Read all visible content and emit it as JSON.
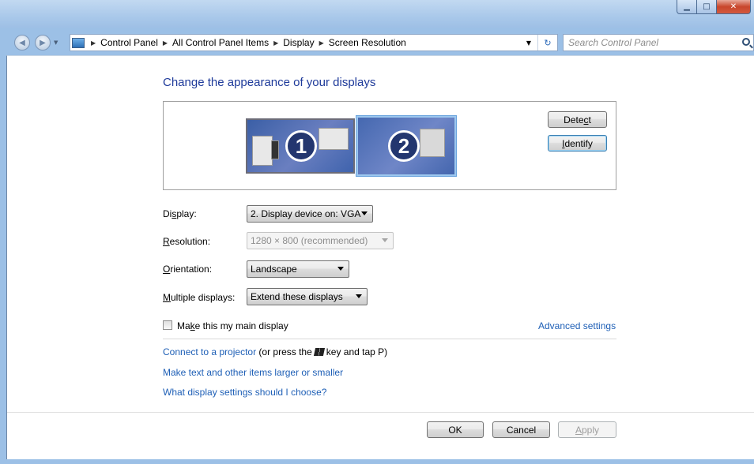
{
  "breadcrumb": [
    "Control Panel",
    "All Control Panel Items",
    "Display",
    "Screen Resolution"
  ],
  "search": {
    "placeholder": "Search Control Panel"
  },
  "page_title": "Change the appearance of your displays",
  "monitors": [
    {
      "number": "1",
      "selected": false
    },
    {
      "number": "2",
      "selected": true
    }
  ],
  "buttons": {
    "detect": {
      "pre": "Dete",
      "key": "c",
      "post": "t"
    },
    "identify": {
      "pre": "",
      "key": "I",
      "post": "dentify"
    },
    "ok": "OK",
    "cancel": "Cancel",
    "apply": {
      "pre": "",
      "key": "A",
      "post": "pply"
    }
  },
  "fields": {
    "display": {
      "label_pre": "Di",
      "label_key": "s",
      "label_post": "play:",
      "value": "2. Display device on: VGA"
    },
    "resolution": {
      "label_pre": "",
      "label_key": "R",
      "label_post": "esolution:",
      "value": "1280 × 800 (recommended)",
      "disabled": true
    },
    "orientation": {
      "label_pre": "",
      "label_key": "O",
      "label_post": "rientation:",
      "value": "Landscape"
    },
    "multiple": {
      "label_pre": "",
      "label_key": "M",
      "label_post": "ultiple displays:",
      "value": "Extend these displays"
    }
  },
  "main_display_checkbox": {
    "label_pre": "Ma",
    "label_key": "k",
    "label_post": "e this my main display",
    "checked": false
  },
  "links": {
    "advanced": "Advanced settings",
    "projector": "Connect to a projector",
    "projector_suffix_pre": "(or press the",
    "projector_suffix_post": "key and tap P)",
    "text_size": "Make text and other items larger or smaller",
    "what_settings": "What display settings should I choose?"
  }
}
